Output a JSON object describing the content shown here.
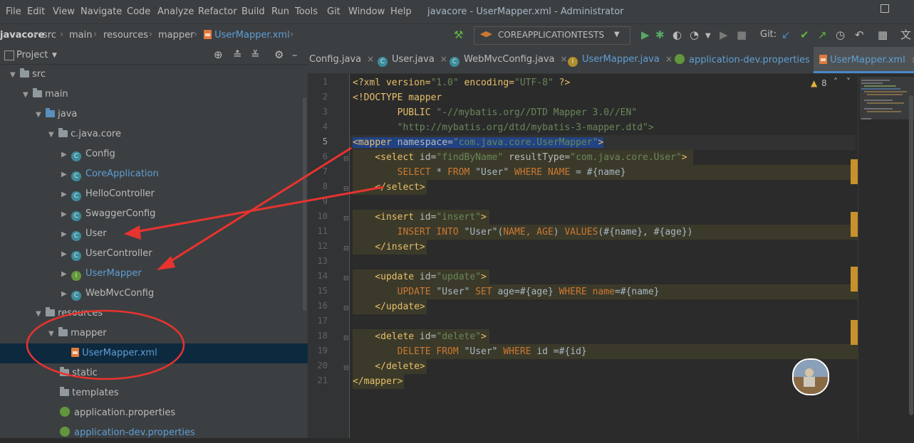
{
  "menubar": {
    "items": [
      "File",
      "Edit",
      "View",
      "Navigate",
      "Code",
      "Analyze",
      "Refactor",
      "Build",
      "Run",
      "Tools",
      "Git",
      "Window",
      "Help"
    ],
    "window_title": "javacore - UserMapper.xml - Administrator"
  },
  "navbar": {
    "breadcrumbs": [
      "javacore",
      "src",
      "main",
      "resources",
      "mapper",
      "UserMapper.xml"
    ],
    "run_config": "COREAPPLICATIONTESTS",
    "git_label": "Git:"
  },
  "project_panel": {
    "title": "Project",
    "tree": [
      {
        "label": "src",
        "kind": "folder"
      },
      {
        "label": "main",
        "kind": "folder"
      },
      {
        "label": "java",
        "kind": "folder-blue"
      },
      {
        "label": "c.java.core",
        "kind": "package"
      },
      {
        "label": "Config",
        "kind": "class"
      },
      {
        "label": "CoreApplication",
        "kind": "class-app"
      },
      {
        "label": "HelloController",
        "kind": "class"
      },
      {
        "label": "SwaggerConfig",
        "kind": "class"
      },
      {
        "label": "User",
        "kind": "class"
      },
      {
        "label": "UserController",
        "kind": "class"
      },
      {
        "label": "UserMapper",
        "kind": "interface"
      },
      {
        "label": "WebMvcConfig",
        "kind": "class"
      },
      {
        "label": "resources",
        "kind": "folder"
      },
      {
        "label": "mapper",
        "kind": "folder"
      },
      {
        "label": "UserMapper.xml",
        "kind": "xml"
      },
      {
        "label": "static",
        "kind": "folder"
      },
      {
        "label": "templates",
        "kind": "folder"
      },
      {
        "label": "application.properties",
        "kind": "properties"
      },
      {
        "label": "application-dev.properties",
        "kind": "properties"
      }
    ]
  },
  "tabs": [
    {
      "label": "Config.java",
      "icon": "class-icon"
    },
    {
      "label": "User.java",
      "icon": "class-icon"
    },
    {
      "label": "WebMvcConfig.java",
      "icon": "class-icon"
    },
    {
      "label": "UserMapper.java",
      "icon": "interface-icon"
    },
    {
      "label": "application-dev.properties",
      "icon": "properties-icon"
    },
    {
      "label": "UserMapper.xml",
      "icon": "xml-icon",
      "active": true
    }
  ],
  "editor": {
    "warnings_count": "8",
    "line_numbers": [
      "1",
      "2",
      "3",
      "4",
      "5",
      "6",
      "7",
      "8",
      "9",
      "10",
      "11",
      "12",
      "13",
      "14",
      "15",
      "16",
      "17",
      "18",
      "19",
      "20",
      "21"
    ],
    "code": {
      "l1_a": "<?xml version=",
      "l1_b": "\"1.0\"",
      "l1_c": " encoding=",
      "l1_d": "\"UTF-8\"",
      "l1_e": " ?>",
      "l2": "<!DOCTYPE mapper",
      "l3_a": "        PUBLIC ",
      "l3_b": "\"-//mybatis.org//DTD Mapper 3.0//EN\"",
      "l4": "        \"http://mybatis.org/dtd/mybatis-3-mapper.dtd\">",
      "l5_a": "<mapper ",
      "l5_b": "namespace=",
      "l5_c": "\"com.java.core.UserMapper\"",
      "l5_d": ">",
      "l6_a": "    <select ",
      "l6_b": "id=",
      "l6_c": "\"findByName\"",
      "l6_d": " resultType=",
      "l6_e": "\"com.java.core.User\"",
      "l6_f": ">",
      "l7_a": "        SELECT ",
      "l7_b": "* ",
      "l7_c": "FROM ",
      "l7_d": "\"User\" ",
      "l7_e": "WHERE NAME ",
      "l7_f": "= #{name}",
      "l8": "    </select>",
      "l10_a": "    <insert ",
      "l10_b": "id=",
      "l10_c": "\"insert\"",
      "l10_d": ">",
      "l11_a": "        INSERT INTO ",
      "l11_b": "\"User\"(",
      "l11_c": "NAME, AGE",
      "l11_d": ") ",
      "l11_e": "VALUES",
      "l11_f": "(#{name}, #{age})",
      "l12": "    </insert>",
      "l14_a": "    <update ",
      "l14_b": "id=",
      "l14_c": "\"update\"",
      "l14_d": ">",
      "l15_a": "        UPDATE ",
      "l15_b": "\"User\" ",
      "l15_c": "SET ",
      "l15_d": "age=#{age} ",
      "l15_e": "WHERE ",
      "l15_f": "name",
      "l15_g": "=#{name}",
      "l16": "    </update>",
      "l18_a": "    <delete ",
      "l18_b": "id=",
      "l18_c": "\"delete\"",
      "l18_d": ">",
      "l19_a": "        DELETE FROM ",
      "l19_b": "\"User\" ",
      "l19_c": "WHERE ",
      "l19_d": "id =#{id}",
      "l20": "    </delete>",
      "l21": "</mapper>"
    }
  },
  "colors": {
    "annotation": "#e8332f",
    "accent": "#4a88c7",
    "gutter_mark": "#c7912c"
  }
}
